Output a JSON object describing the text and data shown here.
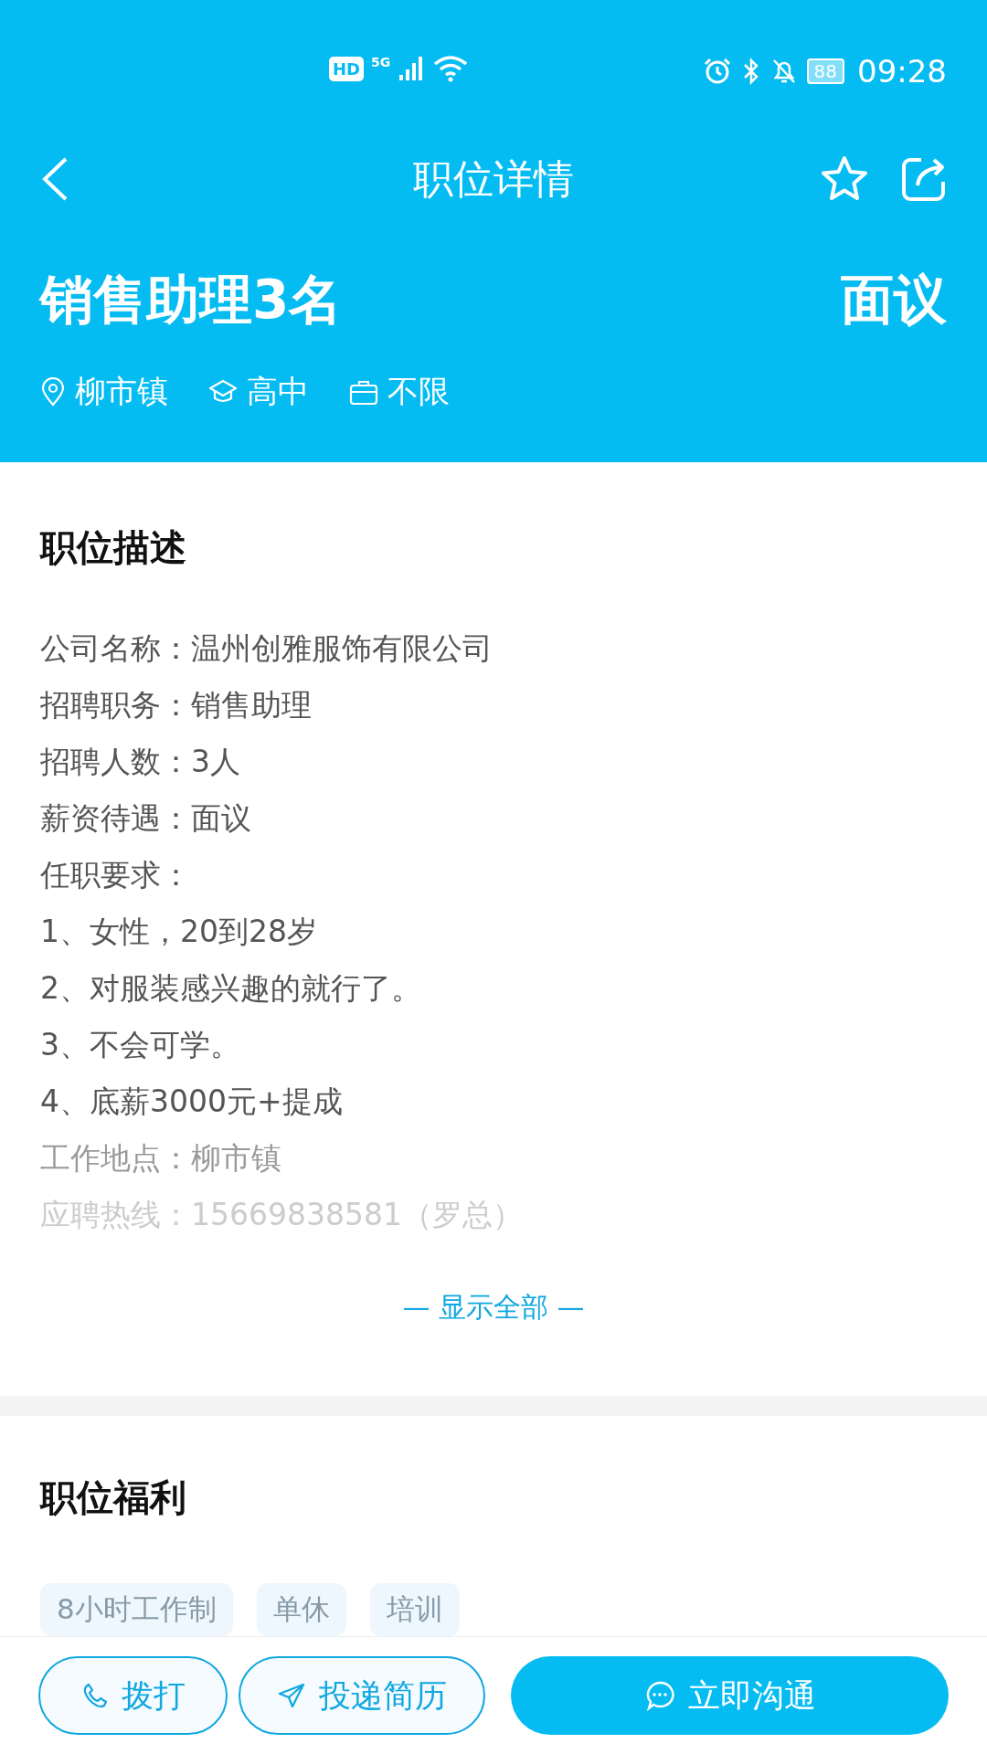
{
  "status_bar": {
    "time": "09:28",
    "battery": "88",
    "network": "5G",
    "hd": "HD"
  },
  "nav": {
    "title": "职位详情"
  },
  "job": {
    "title": "销售助理3名",
    "salary": "面议",
    "meta": [
      {
        "kind": "location",
        "text": "柳市镇"
      },
      {
        "kind": "education",
        "text": "高中"
      },
      {
        "kind": "experience",
        "text": "不限"
      }
    ]
  },
  "description": {
    "heading": "职位描述",
    "lines": [
      {
        "kind": "normal",
        "text": "公司名称：温州创雅服饰有限公司"
      },
      {
        "kind": "normal",
        "text": "招聘职务：销售助理"
      },
      {
        "kind": "normal",
        "text": "招聘人数：3人"
      },
      {
        "kind": "normal",
        "text": "薪资待遇：面议"
      },
      {
        "kind": "normal",
        "text": "任职要求："
      },
      {
        "kind": "normal",
        "text": "1、女性，20到28岁"
      },
      {
        "kind": "normal",
        "text": "2、对服装感兴趣的就行了。"
      },
      {
        "kind": "normal",
        "text": "3、不会可学。"
      },
      {
        "kind": "normal",
        "text": "4、底薪3000元+提成"
      },
      {
        "kind": "faded",
        "text": "工作地点：柳市镇"
      },
      {
        "kind": "faint",
        "text": "应聘热线：15669838581（罗总）"
      }
    ],
    "show_all": "— 显示全部 —"
  },
  "benefits": {
    "heading": "职位福利",
    "tags": [
      "8小时工作制",
      "单休",
      "培训"
    ]
  },
  "actions": [
    {
      "kind": "call",
      "label": "拨打"
    },
    {
      "kind": "resume",
      "label": "投递简历"
    },
    {
      "kind": "chat",
      "label": "立即沟通"
    }
  ]
}
